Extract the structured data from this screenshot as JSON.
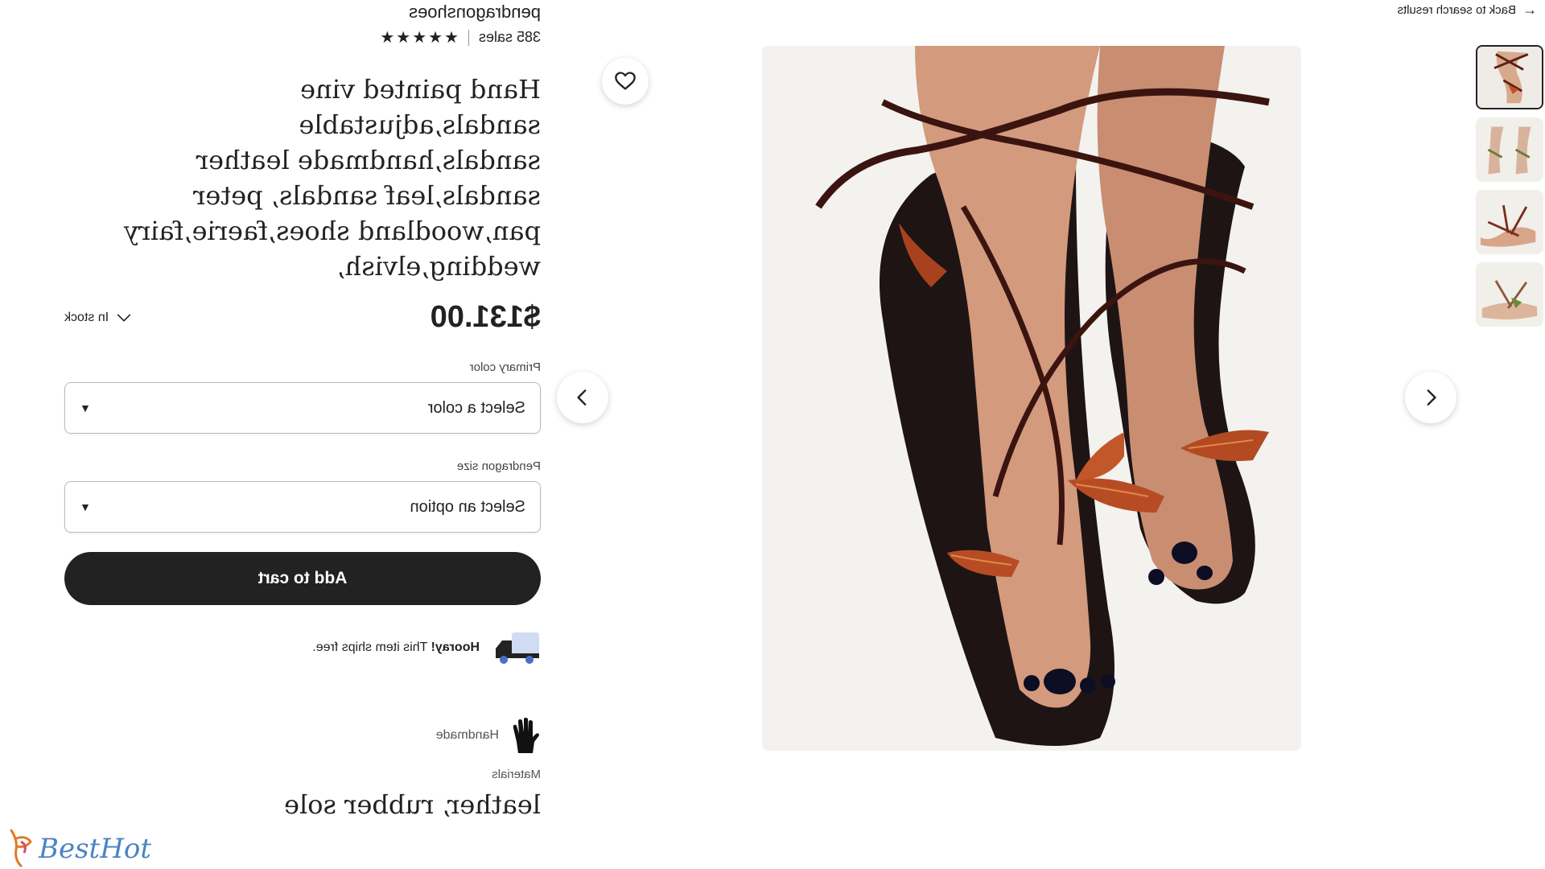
{
  "nav": {
    "back_label": "Back to search results"
  },
  "shop": {
    "name": "pendragonshoes",
    "sales": "385 sales",
    "stars": "★★★★★"
  },
  "product": {
    "title": "Hand painted vine sandals,adjustable sandals,handmade leather sandals,leaf sandals, peter pan,woodland shoes,faerie,fairy wedding,elvish,",
    "price": "$131.00",
    "stock": "In stock"
  },
  "options": {
    "color_label": "Primary color",
    "color_placeholder": "Select a color",
    "size_label": "Pendragon size",
    "size_placeholder": "Select an option"
  },
  "actions": {
    "add_to_cart": "Add to cart"
  },
  "shipping": {
    "bold": "Hooray!",
    "text": " This item ships free."
  },
  "details": {
    "handmade": "Handmade",
    "materials_label": "Materials",
    "materials": "leather, rubber sole"
  },
  "watermark": {
    "text": "BestHot"
  },
  "icons": [
    "arrow-right-icon",
    "heart-icon",
    "chevron-left-icon",
    "chevron-right-icon",
    "chevron-down-icon",
    "truck-icon",
    "hand-icon",
    "caret-down-icon"
  ]
}
